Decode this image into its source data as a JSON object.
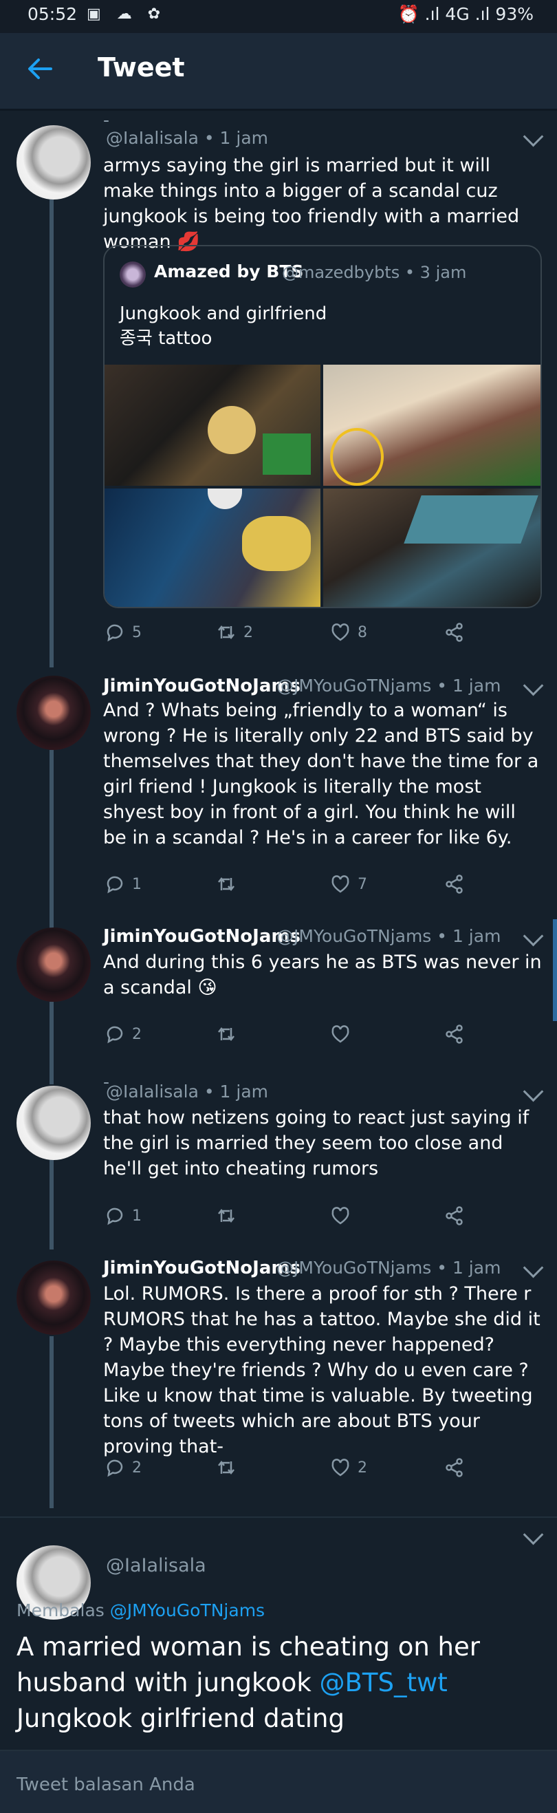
{
  "status_bar": {
    "time": "05:52",
    "left_icons": "▣ ☁ ✿",
    "right": "⏰ .ıl 4G .ıl 93%"
  },
  "header": {
    "title": "Tweet"
  },
  "colors": {
    "background": "#15202b",
    "accent": "#1da1f2",
    "muted": "#8899a6"
  },
  "tweets": [
    {
      "display_name": "-",
      "handle_meta": "@IaIalisala • 1 jam",
      "text": "armys saying the girl is married but it will make things into a bigger of a scandal cuz jungkook is being too friendly with a married woman 💋",
      "replies": "5",
      "retweets": "2",
      "likes": "8",
      "quote": {
        "name": "Amazed by BTS",
        "meta": "@mazedbybts • 3 jam",
        "line1": "Jungkook and girlfriend",
        "line2": "종국 tattoo"
      }
    },
    {
      "display_name": "JiminYouGotNoJams",
      "handle_meta": "@JMYouGoTNjams • 1 jam",
      "text": "And ? Whats being „friendly to a woman“ is wrong ? He is literally only 22 and BTS said by themselves that they don't have the time for a girl friend ! Jungkook is literally the most shyest boy in front of a girl. You think he will be in a scandal ? He's in a career for like 6y.",
      "replies": "1",
      "retweets": "",
      "likes": "7"
    },
    {
      "display_name": "JiminYouGotNoJams",
      "handle_meta": "@JMYouGoTNjams • 1 jam",
      "text": "And during this 6 years he as BTS was never in a scandal 😘",
      "replies": "2",
      "retweets": "",
      "likes": ""
    },
    {
      "display_name": "-",
      "handle_meta": "@IaIalisala • 1 jam",
      "text": "that how netizens going to react just saying if the girl is married they seem too close and he'll get into cheating rumors",
      "replies": "1",
      "retweets": "",
      "likes": ""
    },
    {
      "display_name": "JiminYouGotNoJams",
      "handle_meta": "@JMYouGoTNjams • 1 jam",
      "text": "Lol. RUMORS. Is there a proof for sth ? There r RUMORS that he has a tattoo. Maybe she did it ? Maybe this everything never happened? Maybe they're friends ? Why do u even care ? Like u know that time is valuable. By tweeting tons of tweets which are about BTS your proving that-",
      "replies": "2",
      "retweets": "",
      "likes": "2"
    }
  ],
  "main_tweet": {
    "handle": "@IaIalisala",
    "replying_prefix": "Membalas",
    "replying_to": "@JMYouGoTNjams",
    "text_before": "A married woman is cheating on her husband with jungkook ",
    "mention": "@BTS_twt",
    "text_after": " Jungkook girlfriend dating"
  },
  "compose": {
    "placeholder": "Tweet balasan Anda"
  }
}
